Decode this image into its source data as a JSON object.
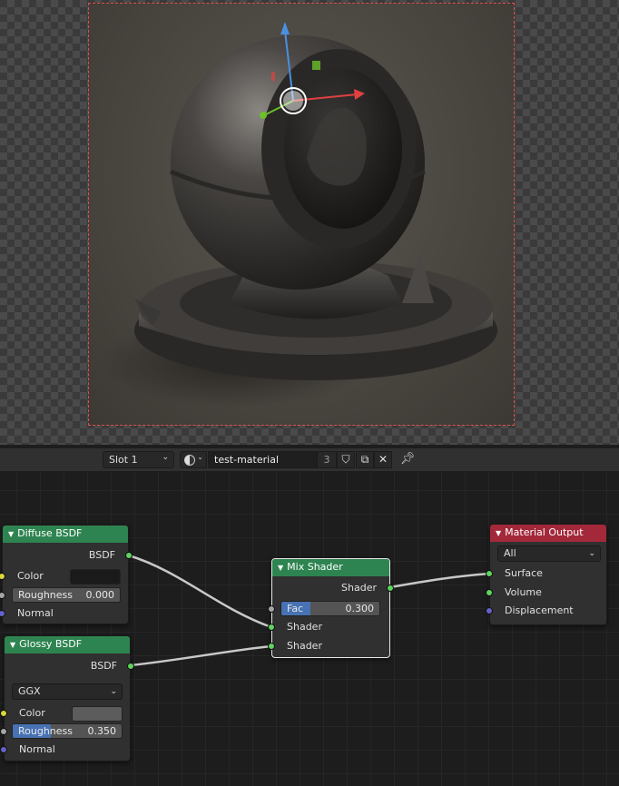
{
  "header": {
    "slot": "Slot 1",
    "material_name": "test-material",
    "user_count": "3"
  },
  "nodes": {
    "diffuse": {
      "title": "Diffuse BSDF",
      "output": "BSDF",
      "color_label": "Color",
      "color_value": "#1a1a1a",
      "roughness_label": "Roughness",
      "roughness_value": "0.000",
      "normal_label": "Normal"
    },
    "glossy": {
      "title": "Glossy BSDF",
      "output": "BSDF",
      "distribution": "GGX",
      "color_label": "Color",
      "color_value": "#5c5c5c",
      "roughness_label": "Roughness",
      "roughness_value": "0.350",
      "normal_label": "Normal"
    },
    "mix": {
      "title": "Mix Shader",
      "output": "Shader",
      "fac_label": "Fac",
      "fac_value": "0.300",
      "shader_a": "Shader",
      "shader_b": "Shader"
    },
    "output": {
      "title": "Material Output",
      "target": "All",
      "surface": "Surface",
      "volume": "Volume",
      "displacement": "Displacement"
    }
  },
  "colors": {
    "shader_node_header": "#2e8450",
    "output_node_header": "#a3283a",
    "slider_fill": "#4772b3",
    "shader_socket": "#5fd45f",
    "color_socket": "#d8d83a",
    "float_socket": "#a5a5a5",
    "vector_socket": "#6363c7"
  }
}
